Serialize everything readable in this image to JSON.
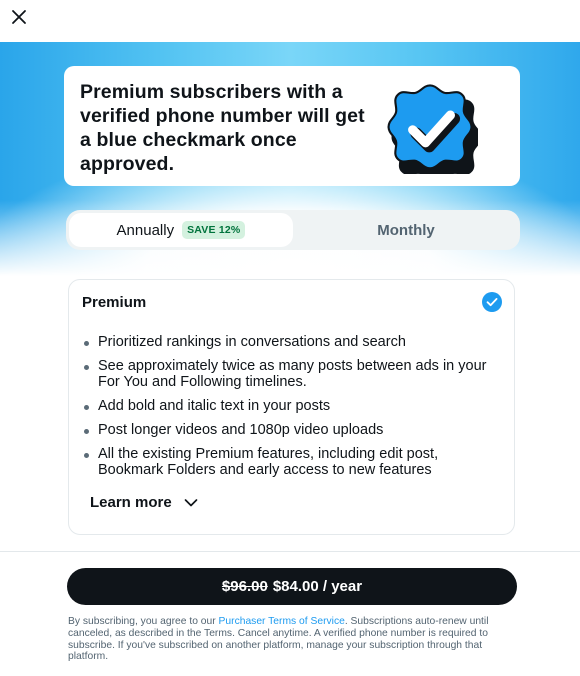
{
  "header": {
    "close_icon": "close-icon"
  },
  "hero": {
    "text": "Premium subscribers with a verified phone number will get a blue checkmark once approved.",
    "badge_icon": "verified-badge-icon"
  },
  "billing_toggle": {
    "annual_label": "Annually",
    "save_badge": "SAVE 12%",
    "monthly_label": "Monthly",
    "selected": "annual"
  },
  "plan": {
    "title": "Premium",
    "selected_icon": "check-circle-icon",
    "features": [
      "Prioritized rankings in conversations and search",
      "See approximately twice as many posts between ads in your For You and Following timelines.",
      "Add bold and italic text in your posts",
      "Post longer videos and 1080p video uploads",
      "All the existing Premium features, including edit post, Bookmark Folders and early access to new features"
    ],
    "learn_more_label": "Learn more",
    "learn_more_icon": "chevron-down-icon"
  },
  "footer": {
    "old_price": "$96.00",
    "price": "$84.00 / year",
    "disclaimer_prefix": "By subscribing, you agree to our ",
    "disclaimer_link": "Purchaser Terms of Service",
    "disclaimer_suffix": ". Subscriptions auto-renew until canceled, as described in the Terms. Cancel anytime. A verified phone number is required to subscribe. If you've subscribed on another platform, manage your subscription through that platform."
  },
  "colors": {
    "accent": "#1d9bf0",
    "text": "#0f1419",
    "muted": "#536471",
    "save_badge_bg": "#d4f1df",
    "save_badge_text": "#00733c"
  }
}
